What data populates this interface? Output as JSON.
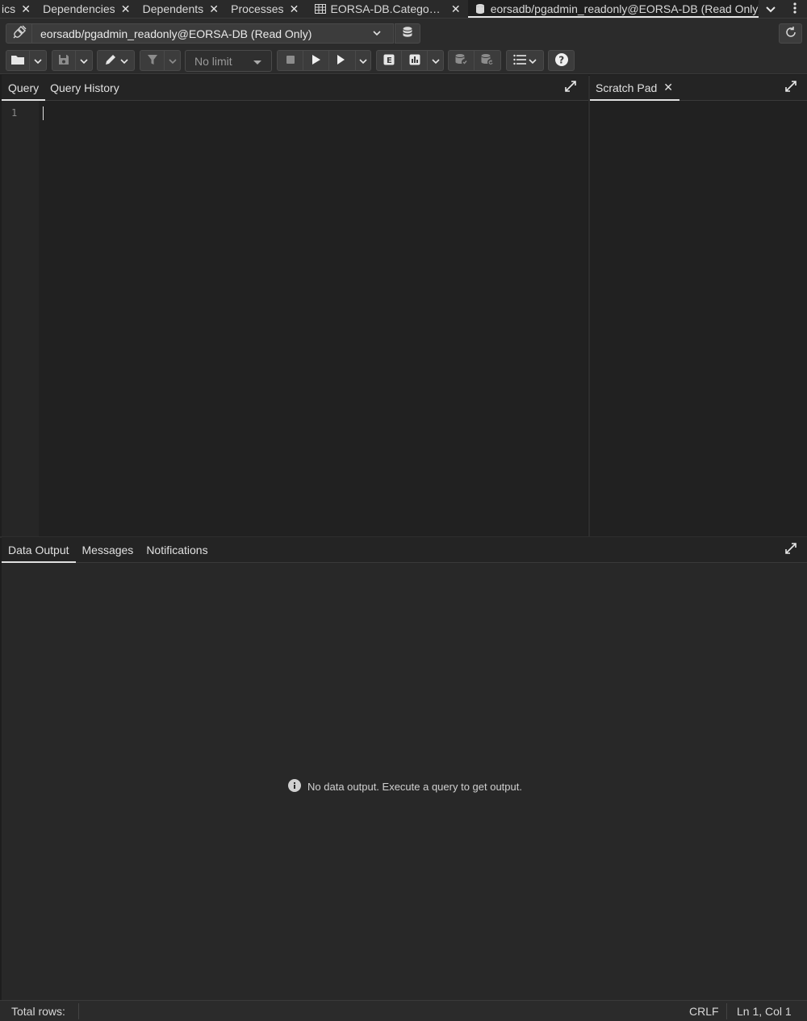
{
  "tabs": [
    {
      "label": "ics",
      "closable": true
    },
    {
      "label": "Dependencies",
      "closable": true
    },
    {
      "label": "Dependents",
      "closable": true
    },
    {
      "label": "Processes",
      "closable": true
    },
    {
      "label": "EORSA-DB.Catego…",
      "closable": true,
      "icon": "table-icon"
    },
    {
      "label": "eorsadb/pgadmin_readonly@EORSA-DB (Read Only)",
      "closable": true,
      "icon": "database-icon",
      "active": true
    }
  ],
  "connection": {
    "selected": "eorsadb/pgadmin_readonly@EORSA-DB (Read Only)"
  },
  "toolbar": {
    "limit_value": "No limit"
  },
  "query_pane": {
    "tabs": [
      "Query",
      "Query History"
    ],
    "active_tab": "Query",
    "line_numbers": [
      "1"
    ]
  },
  "scratch_pad": {
    "title": "Scratch Pad"
  },
  "output_pane": {
    "tabs": [
      "Data Output",
      "Messages",
      "Notifications"
    ],
    "active_tab": "Data Output",
    "empty_message": "No data output. Execute a query to get output."
  },
  "status": {
    "total_rows_label": "Total rows:",
    "line_ending": "CRLF",
    "cursor_position": "Ln 1, Col 1"
  },
  "colors": {
    "background": "#1e1e1e",
    "panel": "#2b2b2b",
    "button": "#3c3c3c",
    "text": "#e0e0e0"
  }
}
